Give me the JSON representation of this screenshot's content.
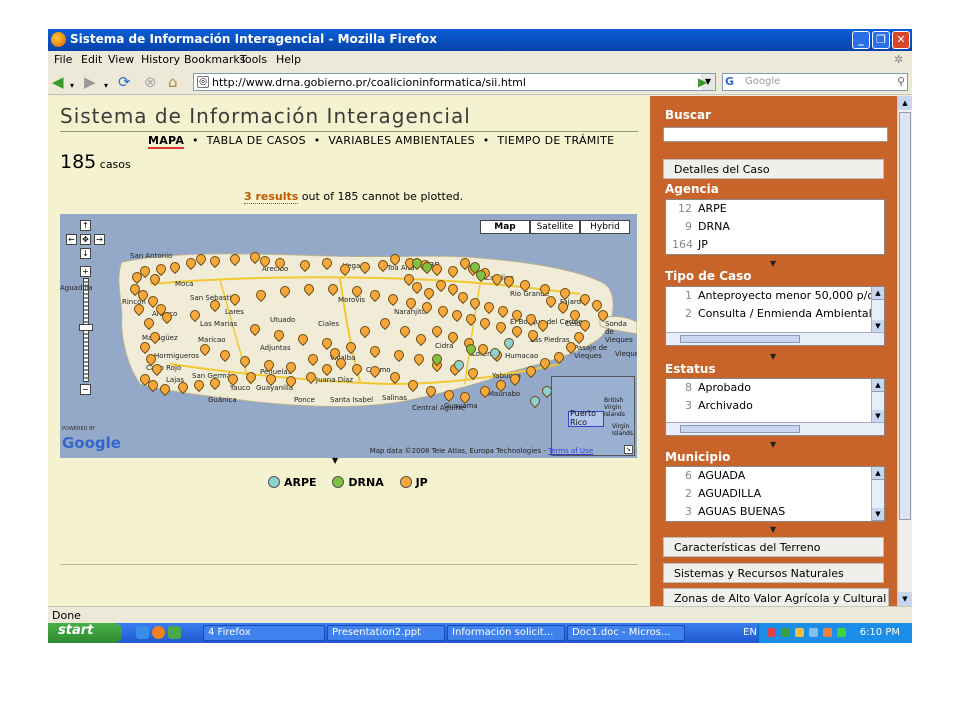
{
  "window": {
    "title": "Sistema de Información Interagencial - Mozilla Firefox"
  },
  "menu": [
    "File",
    "Edit",
    "View",
    "History",
    "Bookmarks",
    "Tools",
    "Help"
  ],
  "nav": {
    "url": "http://www.drna.gobierno.pr/coalicioninformatica/sii.html",
    "search_placeholder": "Google"
  },
  "page": {
    "title": "Sistema de Información Interagencial",
    "tabs": [
      "MAPA",
      "TABLA DE CASOS",
      "VARIABLES AMBIENTALES",
      "TIEMPO DE TRÁMITE"
    ],
    "tab_separator": "•",
    "count": "185",
    "count_unit": "casos",
    "results_link": "3 results",
    "results_text": "out of 185 cannot be plotted."
  },
  "map": {
    "types": [
      "Map",
      "Satellite",
      "Hybrid"
    ],
    "credit": "Map data ©2008 Tele Atlas, Europa Technologies -",
    "terms": "Terms of Use",
    "powered_by": "POWERED BY",
    "logo": "Google",
    "towns": [
      "San Antonio",
      "Arecibo",
      "Vega",
      "Toa Alta",
      "San",
      "Carolina",
      "Moca",
      "San Sebastián",
      "Lares",
      "Utuado",
      "Las Marias",
      "Maricao",
      "Morovis",
      "Naranjito",
      "Rio Grande",
      "El Bosque del Caribe",
      "Fajardo",
      "Ceiba",
      "Las Piedras",
      "Humacao",
      "Lorenzo",
      "Cidra",
      "Ciales",
      "Adjuntas",
      "Villalba",
      "Coamo",
      "Juana Díaz",
      "Peñuelas",
      "San Germán",
      "Lajas",
      "Guánica",
      "Yauco",
      "Guayanilla",
      "Ponce",
      "Santa Isabel",
      "Salinas",
      "Guayama",
      "Maunabo",
      "Yabucoa",
      "Central Aguirre",
      "Añasco",
      "Rincón",
      "Mayagüez",
      "Hormigueros",
      "Cabo Rojo",
      "Aguadilla",
      "Sonda de Vieques",
      "Pasaje de Vieques",
      "Vieques"
    ],
    "inset_labels": [
      "British Virgin Islands",
      "Puerto Rico",
      "Virgin Islands"
    ]
  },
  "legend": [
    {
      "label": "ARPE",
      "color": "#8fd0d0"
    },
    {
      "label": "DRNA",
      "color": "#7dc242"
    },
    {
      "label": "JP",
      "color": "#f7a83a"
    }
  ],
  "sidebar": {
    "buscar": "Buscar",
    "detalles_button": "Detalles del Caso",
    "agencia": {
      "heading": "Agencia",
      "items": [
        {
          "count": "12",
          "label": "ARPE"
        },
        {
          "count": "9",
          "label": "DRNA"
        },
        {
          "count": "164",
          "label": "JP"
        }
      ]
    },
    "tipo": {
      "heading": "Tipo de Caso",
      "items": [
        {
          "count": "1",
          "label": "Anteproyecto menor 50,000 p/c"
        },
        {
          "count": "2",
          "label": "Consulta / Enmienda Ambiental"
        }
      ]
    },
    "estatus": {
      "heading": "Estatus",
      "items": [
        {
          "count": "8",
          "label": "Aprobado"
        },
        {
          "count": "3",
          "label": "Archivado"
        }
      ]
    },
    "municipio": {
      "heading": "Municipio",
      "items": [
        {
          "count": "6",
          "label": "AGUADA"
        },
        {
          "count": "2",
          "label": "AGUADILLA"
        },
        {
          "count": "3",
          "label": "AGUAS BUENAS"
        }
      ]
    },
    "buttons": [
      "Características del Terreno",
      "Sistemas y Recursos Naturales",
      "Zonas de Alto Valor Agrícola y Cultural"
    ]
  },
  "status": "Done",
  "taskbar": {
    "start": "start",
    "tasks": [
      "4 Firefox",
      "Presentation2.ppt",
      "Información solicit...",
      "Doc1.doc - Micros..."
    ],
    "language": "EN",
    "clock": "6:10 PM"
  },
  "colors": {
    "accent_sidebar": "#c8642a",
    "page_bg": "#f5f3cf",
    "marker_jp": "#f7a83a",
    "marker_drna": "#7dc242",
    "marker_arpe": "#8fd0d0"
  }
}
